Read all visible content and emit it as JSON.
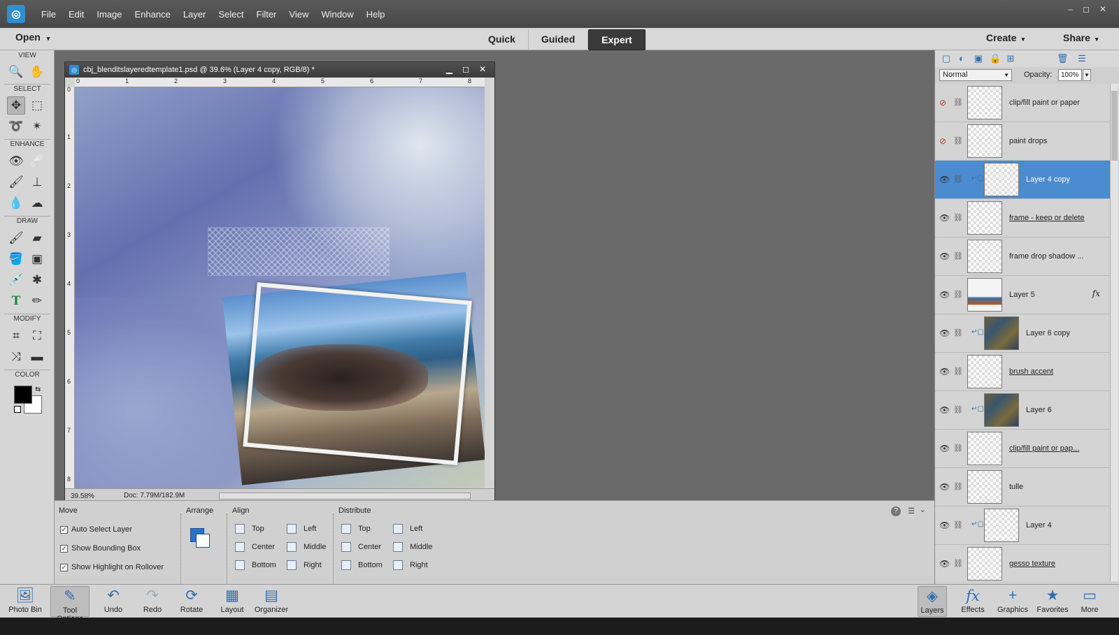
{
  "menubar": {
    "logo": "PSE",
    "items": [
      "File",
      "Edit",
      "Image",
      "Enhance",
      "Layer",
      "Select",
      "Filter",
      "View",
      "Window",
      "Help"
    ],
    "window_controls": [
      "–",
      "◻",
      "✕"
    ]
  },
  "modebar": {
    "open": "Open",
    "modes": [
      "Quick",
      "Guided",
      "Expert"
    ],
    "active_mode": "Expert",
    "create": "Create",
    "share": "Share"
  },
  "toolbox": {
    "sections": [
      "VIEW",
      "SELECT",
      "ENHANCE",
      "DRAW",
      "MODIFY",
      "COLOR"
    ],
    "tools": {
      "zoom": "zoom-icon",
      "hand": "hand-icon",
      "move": "move-icon",
      "marquee": "marquee-icon",
      "lasso": "lasso-icon",
      "magic_wand": "magic-wand-icon",
      "red_eye": "red-eye-icon",
      "spot_heal": "healing-brush-icon",
      "smart_brush": "smart-brush-icon",
      "clone": "clone-stamp-icon",
      "blur": "blur-icon",
      "sponge": "sponge-icon",
      "brush": "brush-icon",
      "eraser": "eraser-icon",
      "paint_bucket": "paint-bucket-icon",
      "gradient": "gradient-icon",
      "eyedropper": "eyedropper-icon",
      "custom_shape": "custom-shape-icon",
      "type": "T",
      "pencil": "pencil-icon",
      "crop": "crop-icon",
      "recompose": "recompose-icon",
      "content_move": "content-aware-move-icon",
      "straighten": "straighten-icon"
    },
    "colors": {
      "foreground": "#000000",
      "background": "#ffffff"
    }
  },
  "document": {
    "title": "cbj_blenditslayeredtemplate1.psd @ 39.6% (Layer 4 copy, RGB/8) *",
    "ruler_h": [
      "0",
      "1",
      "2",
      "3",
      "4",
      "5",
      "6",
      "7",
      "8"
    ],
    "ruler_v": [
      "0",
      "1",
      "2",
      "3",
      "4",
      "5",
      "6",
      "7",
      "8"
    ],
    "zoom": "39.58%",
    "doc_size": "Doc: 7.79M/182.9M"
  },
  "tool_options": {
    "tool_name": "Move",
    "checkboxes": [
      {
        "label": "Auto Select Layer",
        "checked": true
      },
      {
        "label": "Show Bounding Box",
        "checked": true
      },
      {
        "label": "Show Highlight on Rollover",
        "checked": true
      }
    ],
    "arrange_label": "Arrange",
    "align_label": "Align",
    "align": [
      "Top",
      "Center",
      "Bottom",
      "Left",
      "Middle",
      "Right"
    ],
    "distribute_label": "Distribute",
    "distribute": [
      "Top",
      "Center",
      "Bottom",
      "Left",
      "Middle",
      "Right"
    ],
    "help": "?"
  },
  "layers_panel": {
    "blend_mode": "Normal",
    "opacity_label": "Opacity:",
    "opacity": "100%",
    "layers": [
      {
        "name": "clip/fill paint or paper",
        "visible": false,
        "clipped": false,
        "underline": false,
        "active": false,
        "fx": false
      },
      {
        "name": "paint drops",
        "visible": false,
        "clipped": false,
        "underline": false,
        "active": false,
        "fx": false
      },
      {
        "name": "Layer 4 copy",
        "visible": true,
        "clipped": true,
        "underline": false,
        "active": true,
        "fx": false
      },
      {
        "name": "frame - keep or delete",
        "visible": true,
        "clipped": false,
        "underline": true,
        "active": false,
        "fx": false
      },
      {
        "name": "frame drop shadow ...",
        "visible": true,
        "clipped": false,
        "underline": false,
        "active": false,
        "fx": false
      },
      {
        "name": "Layer 5",
        "visible": true,
        "clipped": false,
        "underline": false,
        "active": false,
        "fx": true
      },
      {
        "name": "Layer 6 copy",
        "visible": true,
        "clipped": true,
        "underline": false,
        "active": false,
        "fx": false
      },
      {
        "name": "brush accent",
        "visible": true,
        "clipped": false,
        "underline": true,
        "active": false,
        "fx": false
      },
      {
        "name": "Layer 6",
        "visible": true,
        "clipped": true,
        "underline": false,
        "active": false,
        "fx": false
      },
      {
        "name": "clip/fill paint or pap...",
        "visible": true,
        "clipped": false,
        "underline": true,
        "active": false,
        "fx": false
      },
      {
        "name": "tulle",
        "visible": true,
        "clipped": false,
        "underline": false,
        "active": false,
        "fx": false
      },
      {
        "name": "Layer 4",
        "visible": true,
        "clipped": true,
        "underline": false,
        "active": false,
        "fx": false
      },
      {
        "name": "gesso texture",
        "visible": true,
        "clipped": false,
        "underline": true,
        "active": false,
        "fx": false
      }
    ]
  },
  "bottombar": {
    "left": [
      "Photo Bin",
      "Tool Options",
      "Undo",
      "Redo",
      "Rotate",
      "Layout",
      "Organizer"
    ],
    "right": [
      "Layers",
      "Effects",
      "Graphics",
      "Favorites",
      "More"
    ]
  }
}
